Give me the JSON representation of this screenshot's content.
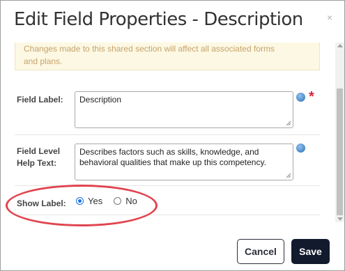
{
  "dialog": {
    "title": "Edit Field Properties - Description",
    "close_symbol": "×"
  },
  "warning": {
    "line1": "Changes made to this shared section will affect all associated forms",
    "line2": "and plans."
  },
  "fields": {
    "field_label": {
      "label": "Field Label:",
      "value": "Description",
      "help_icon": "globe-icon",
      "required_mark": "*"
    },
    "help_text": {
      "label_line1": "Field Level",
      "label_line2": "Help Text:",
      "value_line1": "Describes factors such as skills, knowledge, and",
      "value_line2": "behavioral qualities that make up this competency.",
      "help_icon": "globe-icon"
    },
    "show_label": {
      "label": "Show Label:",
      "options": [
        {
          "label": "Yes",
          "checked": true
        },
        {
          "label": "No",
          "checked": false
        }
      ]
    }
  },
  "footer": {
    "cancel_label": "Cancel",
    "save_label": "Save"
  },
  "colors": {
    "annotation": "#e0444f",
    "primary_button": "#121a2e",
    "warning_bg": "#fcf8e3",
    "warning_text": "#c7a26b",
    "required": "#d7263d",
    "radio_accent": "#1a73e8"
  }
}
